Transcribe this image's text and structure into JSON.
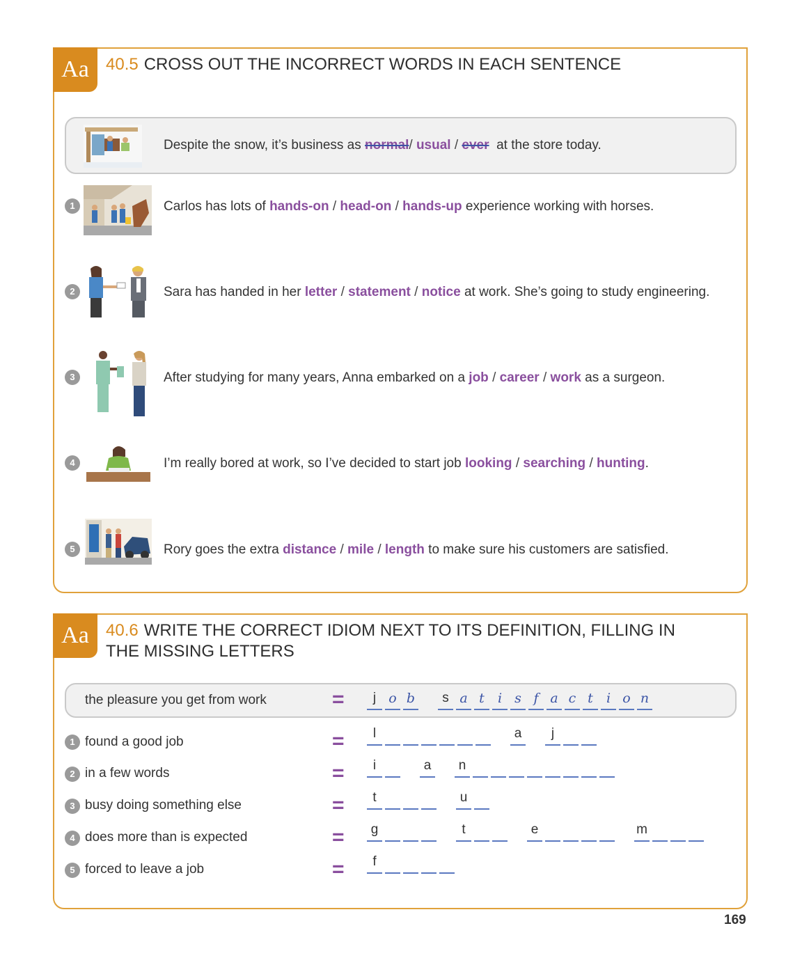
{
  "section1": {
    "badge": "Aa",
    "number": "40.5",
    "title": "CROSS OUT THE INCORRECT WORDS IN EACH SENTENCE",
    "example": {
      "before": "Despite the snow, it’s business as ",
      "options": [
        "normal",
        "usual",
        "ever"
      ],
      "after": "at the store today."
    },
    "items": [
      {
        "num": "1",
        "before": "Carlos has lots of ",
        "options": [
          "hands-on",
          "head-on",
          "hands-up"
        ],
        "after": " experience working with horses."
      },
      {
        "num": "2",
        "before": "Sara has handed in her ",
        "options": [
          "letter",
          "statement",
          "notice"
        ],
        "after": " at work. She’s going to study engineering."
      },
      {
        "num": "3",
        "before": "After studying for many years, Anna embarked on a ",
        "options": [
          "job",
          "career",
          "work"
        ],
        "after": " as a surgeon."
      },
      {
        "num": "4",
        "before": "I’m really bored at work, so I’ve decided to start job ",
        "options": [
          "looking",
          "searching",
          "hunting"
        ],
        "after": "."
      },
      {
        "num": "5",
        "before": "Rory goes the extra ",
        "options": [
          "distance",
          "mile",
          "length"
        ],
        "after": " to make sure his customers are satisfied."
      }
    ],
    "separator": "/"
  },
  "section2": {
    "badge": "Aa",
    "number": "40.6",
    "title_line1": "WRITE THE CORRECT IDIOM NEXT TO ITS DEFINITION, FILLING IN",
    "title_line2": "THE MISSING LETTERS",
    "equals": "=",
    "example": {
      "definition": "the pleasure you get from work",
      "words": [
        [
          "j",
          "o",
          "b"
        ],
        [
          "s",
          "a",
          "t",
          "i",
          "s",
          "f",
          "a",
          "c",
          "t",
          "i",
          "o",
          "n"
        ]
      ],
      "first_letters_printed": [
        "j",
        "s"
      ]
    },
    "items": [
      {
        "num": "1",
        "definition": "found a good job",
        "words": [
          [
            "l",
            "",
            "",
            "",
            "",
            "",
            ""
          ],
          [
            "a"
          ],
          [
            "j",
            "",
            ""
          ]
        ]
      },
      {
        "num": "2",
        "definition": "in a few words",
        "words": [
          [
            "i",
            ""
          ],
          [
            "a"
          ],
          [
            "n",
            "",
            "",
            "",
            "",
            "",
            "",
            "",
            ""
          ]
        ]
      },
      {
        "num": "3",
        "definition": "busy doing something else",
        "words": [
          [
            "t",
            "",
            "",
            ""
          ],
          [
            "u",
            ""
          ]
        ]
      },
      {
        "num": "4",
        "definition": "does more than is expected",
        "words": [
          [
            "g",
            "",
            "",
            ""
          ],
          [
            "t",
            "",
            ""
          ],
          [
            "e",
            "",
            "",
            "",
            ""
          ],
          [
            "m",
            "",
            "",
            ""
          ]
        ]
      },
      {
        "num": "5",
        "definition": "forced to leave a job",
        "words": [
          [
            "f",
            "",
            "",
            "",
            ""
          ]
        ]
      }
    ]
  },
  "page_number": "169",
  "colors": {
    "accent": "#d98b1f",
    "option": "#8a4f9e",
    "handwriting": "#3c55a6"
  },
  "icons": [
    "store-illustration",
    "horse-stable-illustration",
    "handing-notice-illustration",
    "surgeon-illustration",
    "job-hunting-illustration",
    "customer-service-illustration"
  ]
}
